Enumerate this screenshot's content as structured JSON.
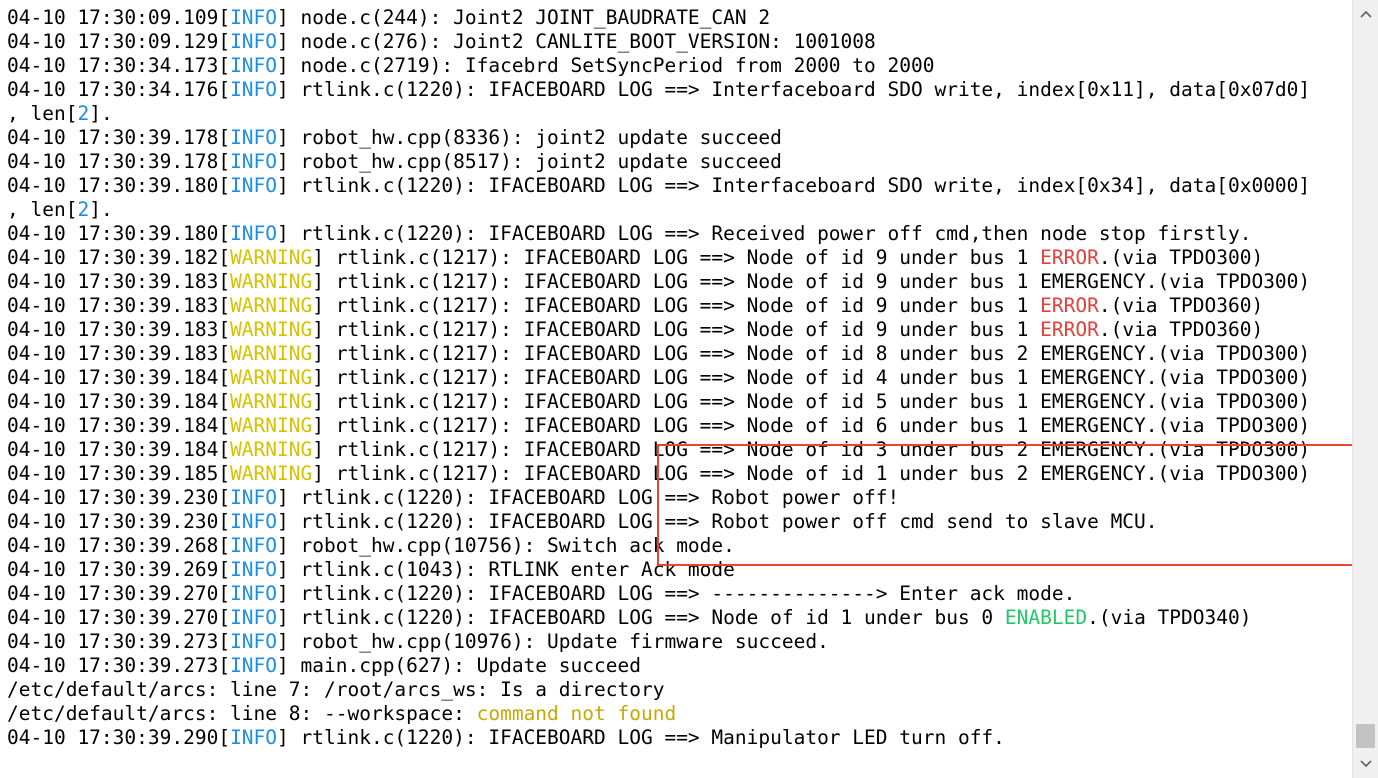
{
  "terminal": {
    "lines": [
      [
        {
          "t": "04-10 17:30:09.109["
        },
        {
          "t": "INFO",
          "c": "info"
        },
        {
          "t": "] node.c(244): Joint2 JOINT_BAUDRATE_CAN 2"
        }
      ],
      [
        {
          "t": "04-10 17:30:09.129["
        },
        {
          "t": "INFO",
          "c": "info"
        },
        {
          "t": "] node.c(276): Joint2 CANLITE_BOOT_VERSION: 1001008"
        }
      ],
      [
        {
          "t": "04-10 17:30:34.173["
        },
        {
          "t": "INFO",
          "c": "info"
        },
        {
          "t": "] node.c(2719): Ifacebrd SetSyncPeriod from 2000 to 2000"
        }
      ],
      [
        {
          "t": "04-10 17:30:34.176["
        },
        {
          "t": "INFO",
          "c": "info"
        },
        {
          "t": "] rtlink.c(1220): IFACEBOARD LOG ==> Interfaceboard SDO write, index[0x11], data[0x07d0]"
        }
      ],
      [
        {
          "t": ", len["
        },
        {
          "t": "2",
          "c": "num"
        },
        {
          "t": "]."
        }
      ],
      [
        {
          "t": "04-10 17:30:39.178["
        },
        {
          "t": "INFO",
          "c": "info"
        },
        {
          "t": "] robot_hw.cpp(8336): joint2 update succeed"
        }
      ],
      [
        {
          "t": "04-10 17:30:39.178["
        },
        {
          "t": "INFO",
          "c": "info"
        },
        {
          "t": "] robot_hw.cpp(8517): joint2 update succeed"
        }
      ],
      [
        {
          "t": "04-10 17:30:39.180["
        },
        {
          "t": "INFO",
          "c": "info"
        },
        {
          "t": "] rtlink.c(1220): IFACEBOARD LOG ==> Interfaceboard SDO write, index[0x34], data[0x0000]"
        }
      ],
      [
        {
          "t": ", len["
        },
        {
          "t": "2",
          "c": "num"
        },
        {
          "t": "]."
        }
      ],
      [
        {
          "t": "04-10 17:30:39.180["
        },
        {
          "t": "INFO",
          "c": "info"
        },
        {
          "t": "] rtlink.c(1220): IFACEBOARD LOG ==> Received power off cmd,then node stop firstly."
        }
      ],
      [
        {
          "t": "04-10 17:30:39.182["
        },
        {
          "t": "WARNING",
          "c": "warning"
        },
        {
          "t": "] rtlink.c(1217): IFACEBOARD LOG ==> Node of id 9 under bus 1 "
        },
        {
          "t": "ERROR",
          "c": "error"
        },
        {
          "t": ".(via TPDO300)"
        }
      ],
      [
        {
          "t": "04-10 17:30:39.183["
        },
        {
          "t": "WARNING",
          "c": "warning"
        },
        {
          "t": "] rtlink.c(1217): IFACEBOARD LOG ==> Node of id 9 under bus 1 EMERGENCY.(via TPDO300)"
        }
      ],
      [
        {
          "t": "04-10 17:30:39.183["
        },
        {
          "t": "WARNING",
          "c": "warning"
        },
        {
          "t": "] rtlink.c(1217): IFACEBOARD LOG ==> Node of id 9 under bus 1 "
        },
        {
          "t": "ERROR",
          "c": "error"
        },
        {
          "t": ".(via TPDO360)"
        }
      ],
      [
        {
          "t": "04-10 17:30:39.183["
        },
        {
          "t": "WARNING",
          "c": "warning"
        },
        {
          "t": "] rtlink.c(1217): IFACEBOARD LOG ==> Node of id 9 under bus 1 "
        },
        {
          "t": "ERROR",
          "c": "error"
        },
        {
          "t": ".(via TPDO360)"
        }
      ],
      [
        {
          "t": "04-10 17:30:39.183["
        },
        {
          "t": "WARNING",
          "c": "warning"
        },
        {
          "t": "] rtlink.c(1217): IFACEBOARD LOG ==> Node of id 8 under bus 2 EMERGENCY.(via TPDO300)"
        }
      ],
      [
        {
          "t": "04-10 17:30:39.184["
        },
        {
          "t": "WARNING",
          "c": "warning"
        },
        {
          "t": "] rtlink.c(1217): IFACEBOARD LOG ==> Node of id 4 under bus 1 EMERGENCY.(via TPDO300)"
        }
      ],
      [
        {
          "t": "04-10 17:30:39.184["
        },
        {
          "t": "WARNING",
          "c": "warning"
        },
        {
          "t": "] rtlink.c(1217): IFACEBOARD LOG ==> Node of id 5 under bus 1 EMERGENCY.(via TPDO300)"
        }
      ],
      [
        {
          "t": "04-10 17:30:39.184["
        },
        {
          "t": "WARNING",
          "c": "warning"
        },
        {
          "t": "] rtlink.c(1217): IFACEBOARD LOG ==> Node of id 6 under bus 1 EMERGENCY.(via TPDO300)"
        }
      ],
      [
        {
          "t": "04-10 17:30:39.184["
        },
        {
          "t": "WARNING",
          "c": "warning"
        },
        {
          "t": "] rtlink.c(1217): IFACEBOARD LOG ==> Node of id 3 under bus 2 EMERGENCY.(via TPDO300)"
        }
      ],
      [
        {
          "t": "04-10 17:30:39.185["
        },
        {
          "t": "WARNING",
          "c": "warning"
        },
        {
          "t": "] rtlink.c(1217): IFACEBOARD LOG ==> Node of id 1 under bus 2 EMERGENCY.(via TPDO300)"
        }
      ],
      [
        {
          "t": "04-10 17:30:39.230["
        },
        {
          "t": "INFO",
          "c": "info"
        },
        {
          "t": "] rtlink.c(1220): IFACEBOARD LOG ==> Robot power off!"
        }
      ],
      [
        {
          "t": "04-10 17:30:39.230["
        },
        {
          "t": "INFO",
          "c": "info"
        },
        {
          "t": "] rtlink.c(1220): IFACEBOARD LOG ==> Robot power off cmd send to slave MCU."
        }
      ],
      [
        {
          "t": "04-10 17:30:39.268["
        },
        {
          "t": "INFO",
          "c": "info"
        },
        {
          "t": "] robot_hw.cpp(10756): Switch ack mode."
        }
      ],
      [
        {
          "t": "04-10 17:30:39.269["
        },
        {
          "t": "INFO",
          "c": "info"
        },
        {
          "t": "] rtlink.c(1043): RTLINK enter Ack mode"
        }
      ],
      [
        {
          "t": "04-10 17:30:39.270["
        },
        {
          "t": "INFO",
          "c": "info"
        },
        {
          "t": "] rtlink.c(1220): IFACEBOARD LOG ==> --------------> Enter ack mode."
        }
      ],
      [
        {
          "t": "04-10 17:30:39.270["
        },
        {
          "t": "INFO",
          "c": "info"
        },
        {
          "t": "] rtlink.c(1220): IFACEBOARD LOG ==> Node of id 1 under bus 0 "
        },
        {
          "t": "ENABLED",
          "c": "enabled"
        },
        {
          "t": ".(via TPDO340)"
        }
      ],
      [
        {
          "t": "04-10 17:30:39.273["
        },
        {
          "t": "INFO",
          "c": "info"
        },
        {
          "t": "] robot_hw.cpp(10976): Update firmware succeed."
        }
      ],
      [
        {
          "t": "04-10 17:30:39.273["
        },
        {
          "t": "INFO",
          "c": "info"
        },
        {
          "t": "] main.cpp(627): Update succeed"
        }
      ],
      [
        {
          "t": "/etc/default/arcs: line 7: /root/arcs_ws: Is a directory"
        }
      ],
      [
        {
          "t": "/etc/default/arcs: line 8: --workspace: "
        },
        {
          "t": "command not found",
          "c": "cmdnf"
        }
      ],
      [
        {
          "t": "04-10 17:30:39.290["
        },
        {
          "t": "INFO",
          "c": "info"
        },
        {
          "t": "] rtlink.c(1220): IFACEBOARD LOG ==> Manipulator LED turn off."
        }
      ]
    ]
  },
  "colors": {
    "info": "#1a8fe3",
    "warning": "#d6c200",
    "error": "#e3423c",
    "enabled": "#22c76a",
    "command_not_found": "#c7a800",
    "highlight_box": "#e8472e"
  },
  "scrollbar": {
    "up_icon": "chevron-up-icon",
    "down_icon": "chevron-down-icon"
  }
}
